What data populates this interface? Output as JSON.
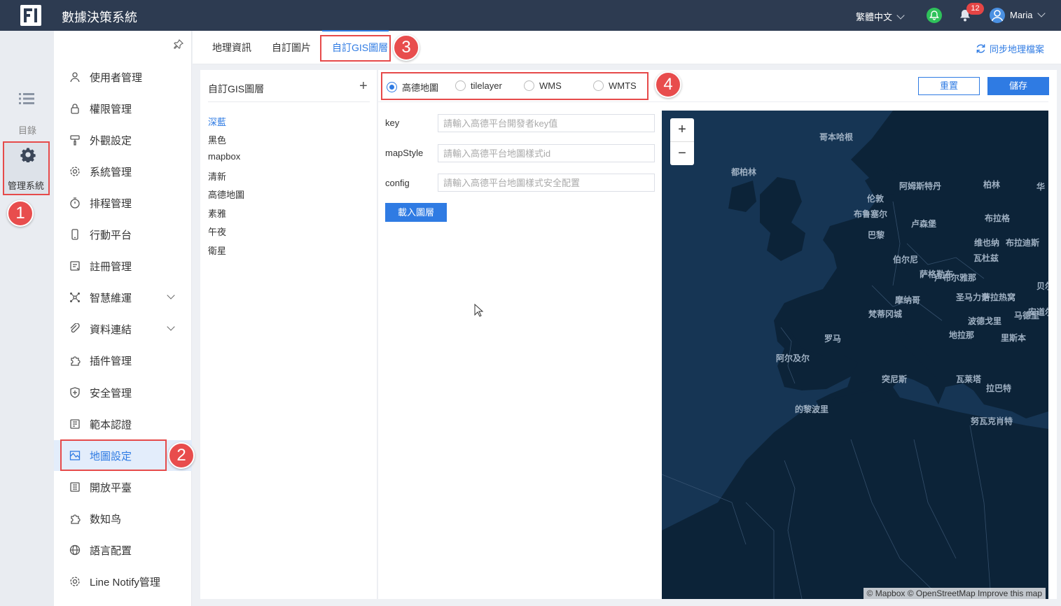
{
  "header": {
    "title": "數據決策系統",
    "language": "繁體中文",
    "notification_count": "12",
    "user": "Maria"
  },
  "rail": {
    "directory_label": "目錄",
    "admin_label": "管理系統"
  },
  "sidebar": {
    "items": [
      {
        "label": "使用者管理",
        "icon": "user-icon"
      },
      {
        "label": "權限管理",
        "icon": "lock-icon"
      },
      {
        "label": "外觀設定",
        "icon": "brush-icon"
      },
      {
        "label": "系統管理",
        "icon": "gear-icon"
      },
      {
        "label": "排程管理",
        "icon": "timer-icon"
      },
      {
        "label": "行動平台",
        "icon": "mobile-icon"
      },
      {
        "label": "註冊管理",
        "icon": "register-icon"
      },
      {
        "label": "智慧維運",
        "icon": "network-icon"
      },
      {
        "label": "資料連結",
        "icon": "link-icon"
      },
      {
        "label": "插件管理",
        "icon": "puzzle-icon"
      },
      {
        "label": "安全管理",
        "icon": "shield-icon"
      },
      {
        "label": "範本認證",
        "icon": "certificate-icon"
      },
      {
        "label": "地圖設定",
        "icon": "map-icon"
      },
      {
        "label": "開放平臺",
        "icon": "list-icon"
      },
      {
        "label": "数知鸟",
        "icon": "puzzle-icon"
      },
      {
        "label": "語言配置",
        "icon": "globe-icon"
      },
      {
        "label": "Line Notify管理",
        "icon": "gear-icon"
      }
    ]
  },
  "tabs": [
    "地理資訊",
    "自訂圖片",
    "自訂GIS圖層"
  ],
  "sync_label": "同步地理檔案",
  "layer_list": {
    "title": "自訂GIS圖層",
    "add": "+",
    "items": [
      "深藍",
      "黑色",
      "mapbox",
      "清新",
      "高德地圖",
      "素雅",
      "午夜",
      "衛星"
    ]
  },
  "form": {
    "radios": [
      "高德地圖",
      "tilelayer",
      "WMS",
      "WMTS"
    ],
    "selected_radio": "高德地圖",
    "reset_label": "重置",
    "save_label": "儲存",
    "fields": [
      {
        "label": "key",
        "placeholder": "請輸入高德平台開發者key值"
      },
      {
        "label": "mapStyle",
        "placeholder": "請輸入高德平台地圖樣式id"
      },
      {
        "label": "config",
        "placeholder": "請輸入高德平台地圖樣式安全配置"
      }
    ],
    "load_label": "載入圖層"
  },
  "map": {
    "zoom_in": "+",
    "zoom_out": "−",
    "cities": [
      "哥本哈根",
      "都柏林",
      "阿姆斯特丹",
      "柏林",
      "华",
      "伦敦",
      "布鲁塞尔",
      "卢森堡",
      "布拉格",
      "巴黎",
      "维也纳",
      "布拉迪斯",
      "伯尔尼",
      "瓦杜兹",
      "萨格勒布",
      "卢布尔雅那",
      "贝尔",
      "摩纳哥",
      "圣马力诺",
      "萨拉热窝",
      "安道尔",
      "梵蒂冈城",
      "波德戈里",
      "马德里",
      "罗马",
      "地拉那",
      "里斯本",
      "阿尔及尔",
      "突尼斯",
      "瓦莱塔",
      "拉巴特",
      "的黎波里",
      "努瓦克肖特"
    ],
    "attribution": "© Mapbox © OpenStreetMap Improve this map"
  },
  "callouts": [
    "1",
    "2",
    "3",
    "4"
  ],
  "colors": {
    "accent": "#2f7be3",
    "header": "#2d3b51",
    "callout": "#e84d4d"
  }
}
